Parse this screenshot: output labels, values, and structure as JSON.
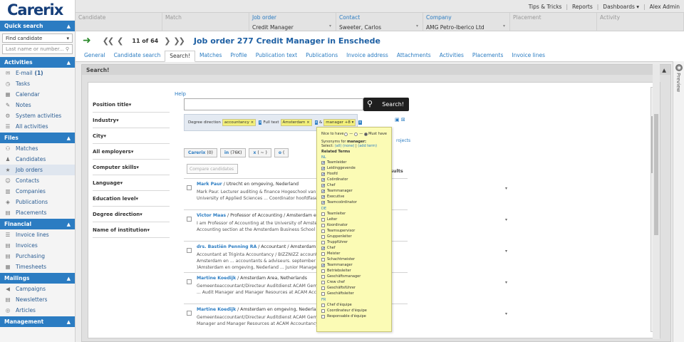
{
  "app": {
    "logo": "Carerix"
  },
  "sidebar": {
    "quick_search": {
      "title": "Quick search",
      "select_value": "Find candidate",
      "input_placeholder": "Last name or number..."
    },
    "sections": [
      {
        "title": "Activities",
        "items": [
          {
            "label": "E-mail",
            "count": "(1)",
            "icon": "mail-icon"
          },
          {
            "label": "Tasks",
            "icon": "clock-icon"
          },
          {
            "label": "Calendar",
            "icon": "calendar-icon"
          },
          {
            "label": "Notes",
            "icon": "note-icon"
          },
          {
            "label": "System activities",
            "icon": "gear-icon"
          },
          {
            "label": "All activities",
            "icon": "list-icon"
          }
        ]
      },
      {
        "title": "Files",
        "items": [
          {
            "label": "Matches",
            "icon": "people-icon"
          },
          {
            "label": "Candidates",
            "icon": "person-icon"
          },
          {
            "label": "Job orders",
            "icon": "star-icon",
            "active": true
          },
          {
            "label": "Contacts",
            "icon": "contact-icon"
          },
          {
            "label": "Companies",
            "icon": "building-icon"
          },
          {
            "label": "Publications",
            "icon": "publish-icon"
          },
          {
            "label": "Placements",
            "icon": "doc-icon"
          }
        ]
      },
      {
        "title": "Financial",
        "items": [
          {
            "label": "Invoice lines",
            "icon": "list-icon"
          },
          {
            "label": "Invoices",
            "icon": "doc-icon"
          },
          {
            "label": "Purchasing",
            "icon": "doc-icon"
          },
          {
            "label": "Timesheets",
            "icon": "calendar-icon"
          }
        ]
      },
      {
        "title": "Mailings",
        "items": [
          {
            "label": "Campaigns",
            "icon": "megaphone-icon"
          },
          {
            "label": "Newsletters",
            "icon": "doc-icon"
          },
          {
            "label": "Articles",
            "icon": "article-icon"
          }
        ]
      },
      {
        "title": "Management",
        "items": []
      }
    ]
  },
  "topbar": {
    "links": [
      "Tips & Tricks",
      "Reports",
      "Dashboards ▾",
      "Alex Admin"
    ]
  },
  "fields": [
    {
      "label": "Candidate",
      "value": "",
      "active": false
    },
    {
      "label": "Match",
      "value": "",
      "active": false
    },
    {
      "label": "Job order",
      "value": "Credit Manager",
      "active": true
    },
    {
      "label": "Contact",
      "value": "Sweeter, Carlos",
      "active": true
    },
    {
      "label": "Company",
      "value": "AMG Petro-Iberico Ltd",
      "active": true
    },
    {
      "label": "Placement",
      "value": "",
      "active": false
    },
    {
      "label": "Activity",
      "value": "",
      "active": false
    }
  ],
  "header": {
    "pager": "11 of 64",
    "title": "Job order 277 Credit Manager in Enschede"
  },
  "tabs": [
    "General",
    "Candidate search",
    "Search!",
    "Matches",
    "Profile",
    "Publication text",
    "Publications",
    "Invoice address",
    "Attachments",
    "Activities",
    "Placements",
    "Invoice lines"
  ],
  "active_tab": "Search!",
  "panel": {
    "title": "Search!"
  },
  "filters": [
    "Position title",
    "Industry",
    "City",
    "All employers",
    "Computer skills",
    "Language",
    "Education level",
    "Degree direction",
    "Name of institution"
  ],
  "search": {
    "help": "Help",
    "button": "Search!"
  },
  "tagbar": {
    "label1": "Degree direction",
    "tag1": "accountancy",
    "label2": "Full text",
    "tag2": "Amsterdam",
    "amp": "&",
    "tag3": "manager +8"
  },
  "projects_link": "rojects",
  "source_tabs": [
    {
      "name": "Carerix",
      "count": "(0)"
    },
    {
      "name": "in",
      "count": "(76K)"
    },
    {
      "name": "x",
      "count": "( ~ )"
    },
    {
      "name": "o",
      "count": "("
    }
  ],
  "compare_label": "Compare candidates",
  "results_label": "sults",
  "results": [
    {
      "name": "Mark Paur",
      "rest": " / Utrecht en omgeving, Nederland",
      "line2": "Mark Paur. Lecturer auditing & finance Hogeschool van Am",
      "line3": "University of Applied Sciences ... Coordinator hoofdfase"
    },
    {
      "name": "Victor Maas",
      "rest": " / Professor of Accounting / Amsterdam en",
      "line2": "I am Professor of Accounting at the University of Amsterda",
      "line3": "Accounting section at the Amsterdam Business School"
    },
    {
      "name": "drs. Bastiën Penning RA",
      "rest": " / Accountant / Amsterdam e",
      "line2": "Accountant at Triginta Accountancy / BIZZNIZZ account",
      "line3": "Amsterdam en ... accountants & adviseurs. september 2",
      "line4": ")Amsterdam en omgeving, Nederland ... Junior Manager"
    },
    {
      "name": "Martine Koedijk",
      "rest": " / Amsterdam Area, Netherlands",
      "line2": "Gemeenteaccountant/Directeur Auditdienst ACAM Geme",
      "line3": "... Audit Manager and Manager Resources at ACAM Acc"
    },
    {
      "name": "Martine Koedijk",
      "rest": " / Amsterdam en omgeving, Nederland",
      "line2": "Gemeenteaccountant/Directeur Auditdienst ACAM Geme",
      "line3": "Manager and Manager Resources at ACAM Accountancy"
    }
  ],
  "popup": {
    "nice": "Nice to have",
    "must": "Must have",
    "syn_prefix": "Synonyms for",
    "syn_word": "manager:",
    "select": "Select:",
    "all": "(all)",
    "none": "(none)",
    "sep": "|",
    "add": "(add term)",
    "related": "Related Terms",
    "groups": [
      {
        "lang": "NL",
        "terms": [
          {
            "t": "Teamleider",
            "c": true
          },
          {
            "t": "Leidinggevende",
            "c": true
          },
          {
            "t": "Hoofd",
            "c": true
          },
          {
            "t": "Coördinator",
            "c": true
          },
          {
            "t": "Chef",
            "c": true
          },
          {
            "t": "Teammanager",
            "c": true
          },
          {
            "t": "Executive",
            "c": true
          },
          {
            "t": "Teamcoördinator",
            "c": true
          }
        ]
      },
      {
        "lang": "DE",
        "terms": [
          {
            "t": "Teamleiter",
            "c": false
          },
          {
            "t": "Leiter",
            "c": false
          },
          {
            "t": "Koordinator",
            "c": false
          },
          {
            "t": "Teamsupervisor",
            "c": false
          },
          {
            "t": "Gruppenleiter",
            "c": false
          },
          {
            "t": "Truppführer",
            "c": false
          },
          {
            "t": "Chef",
            "c": true
          },
          {
            "t": "Meister",
            "c": false
          },
          {
            "t": "Schachtmeister",
            "c": false
          },
          {
            "t": "Teammanager",
            "c": true
          },
          {
            "t": "Betriebsleiter",
            "c": false
          },
          {
            "t": "Geschäftsmanager",
            "c": false
          },
          {
            "t": "Crew chef",
            "c": false
          },
          {
            "t": "Geschäftsführer",
            "c": false
          },
          {
            "t": "Geschäftsleiter",
            "c": false
          }
        ]
      },
      {
        "lang": "FR",
        "terms": [
          {
            "t": "Chef d'équipe",
            "c": false
          },
          {
            "t": "Coordinateur d'équipe",
            "c": false
          },
          {
            "t": "Responsable d'équipe",
            "c": false
          }
        ]
      }
    ]
  },
  "preview_label": "Preview",
  "colors": {
    "accent": "#2b7cc2",
    "brand": "#163f7a",
    "popup": "#fbfbb5",
    "tag": "#f3f07a"
  }
}
